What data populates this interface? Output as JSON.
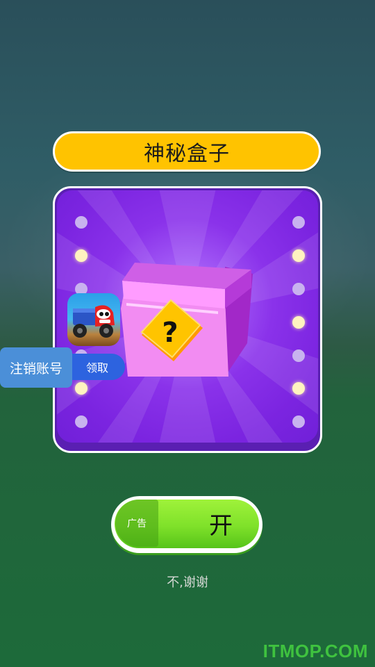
{
  "dialog": {
    "title": "神秘盒子",
    "box_icon": "mystery-box-icon",
    "question_icon": "question-mark-icon",
    "lights_left": [
      false,
      true,
      false,
      true,
      false,
      true,
      false
    ],
    "lights_right": [
      false,
      true,
      false,
      true,
      false,
      true,
      false
    ]
  },
  "overlay": {
    "cancel_account_label": "注销账号",
    "claim_label": "领取",
    "app_icon": "truck-game-app-icon"
  },
  "actions": {
    "open_label": "开",
    "ad_tag": "广告",
    "decline_label": "不,谢谢"
  },
  "watermark": "ITMOP.COM",
  "colors": {
    "title_bg": "#ffc300",
    "card_purple": "#7b24e0",
    "open_green": "#7fe12a",
    "cancel_blue": "#4b8fd8",
    "claim_blue": "#2d63df",
    "watermark_green": "#3fc23f"
  }
}
